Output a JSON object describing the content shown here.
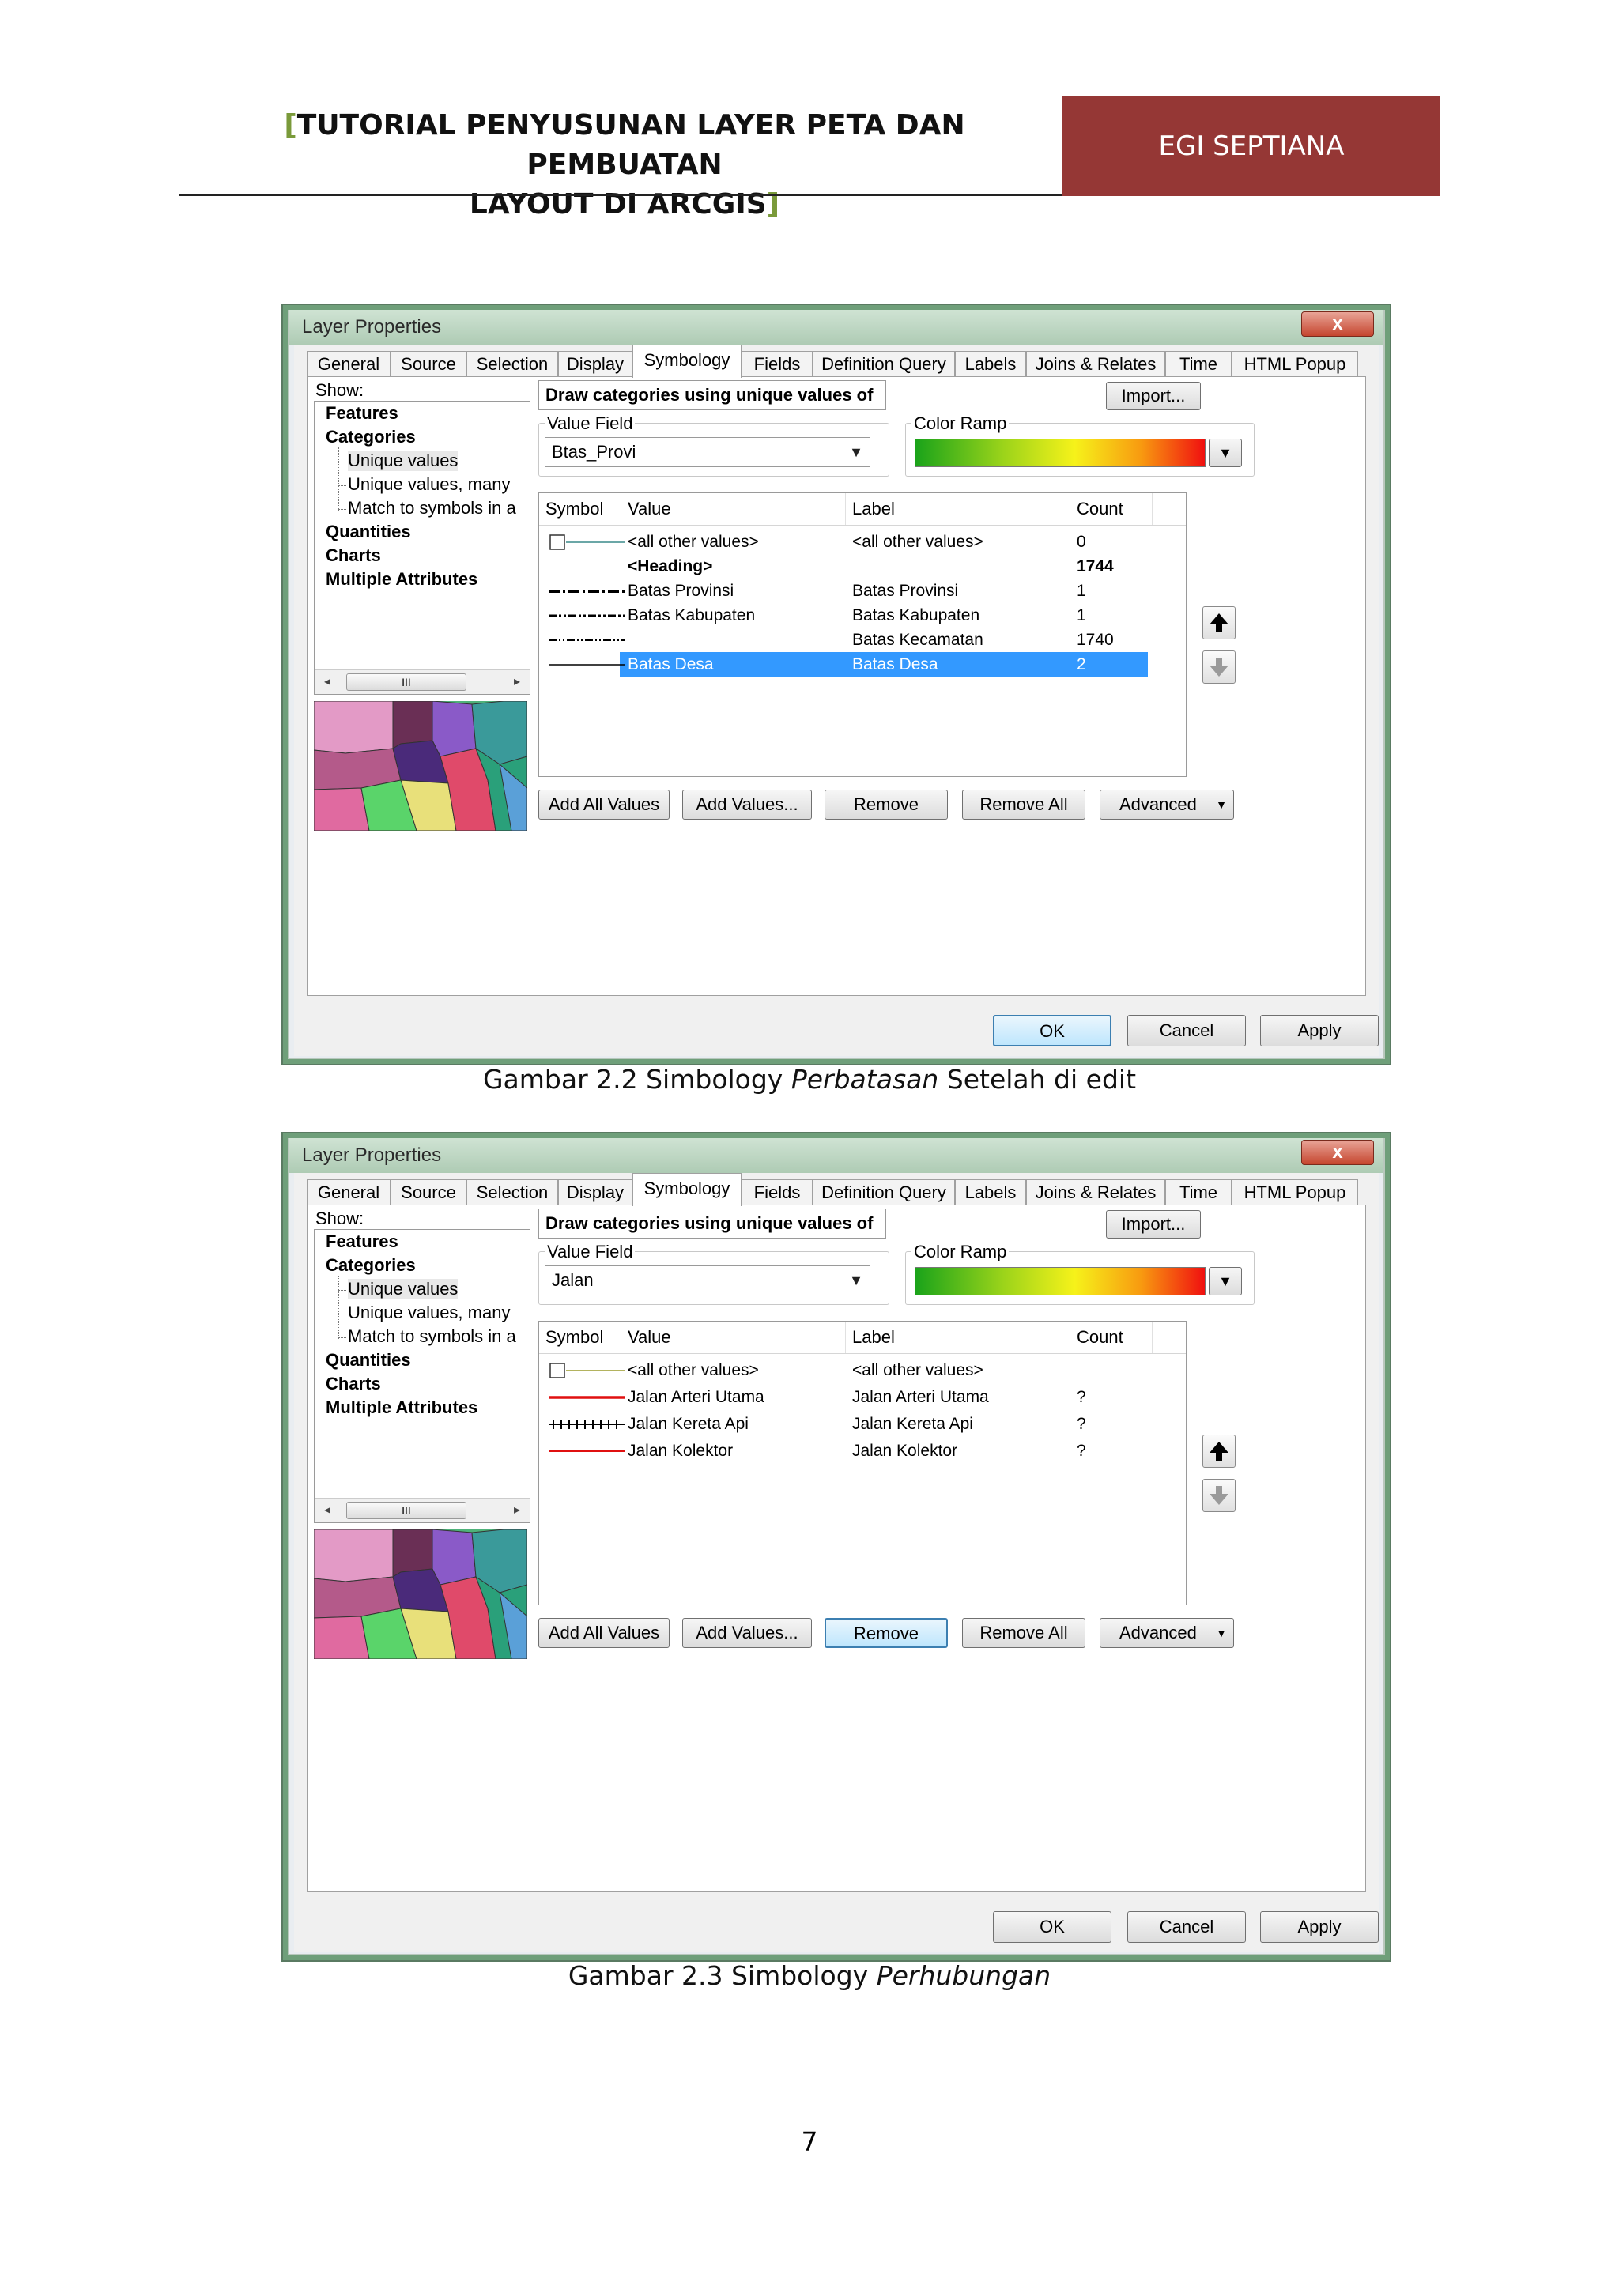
{
  "page": {
    "header_title_line1": "TUTORIAL PENYUSUNAN LAYER PETA DAN PEMBUATAN",
    "header_title_line2": "LAYOUT DI ARCGIS",
    "header_bracket_open": "[",
    "header_bracket_close": "]",
    "author": "EGI SEPTIANA",
    "page_number": "7",
    "colors": {
      "author_box": "#953735",
      "bracket": "#7a9a3a"
    }
  },
  "dialogs": [
    {
      "title": "Layer Properties",
      "close_label": "x",
      "tabs": [
        "General",
        "Source",
        "Selection",
        "Display",
        "Symbology",
        "Fields",
        "Definition Query",
        "Labels",
        "Joins & Relates",
        "Time",
        "HTML Popup"
      ],
      "active_tab": "Symbology",
      "show_label": "Show:",
      "tree": {
        "features": "Features",
        "categories": "Categories",
        "unique_values": "Unique values",
        "unique_values_many": "Unique values, many",
        "match_symbols": "Match to symbols in a",
        "quantities": "Quantities",
        "charts": "Charts",
        "multiple_attributes": "Multiple Attributes"
      },
      "scroll_thumb": "III",
      "draw_categories": "Draw categories using unique values of one field.",
      "import_label": "Import...",
      "value_field_label": "Value Field",
      "value_field": "Btas_Provi",
      "color_ramp_label": "Color Ramp",
      "columns": {
        "symbol": "Symbol",
        "value": "Value",
        "label": "Label",
        "count": "Count"
      },
      "rows": [
        {
          "symbol": "other",
          "value": "<all other values>",
          "label": "<all other values>",
          "count": "0"
        },
        {
          "symbol": "none",
          "value": "<Heading>",
          "label": "",
          "count": "1744",
          "bold": true
        },
        {
          "symbol": "dashdot-thick",
          "value": "Batas Provinsi",
          "label": "Batas Provinsi",
          "count": "1"
        },
        {
          "symbol": "dashdotdot",
          "value": "Batas Kabupaten",
          "label": "Batas Kabupaten",
          "count": "1"
        },
        {
          "symbol": "dashdot-thin",
          "value": "",
          "label": "Batas Kecamatan",
          "count": "1740"
        },
        {
          "symbol": "solid-thin",
          "value": "Batas Desa",
          "label": "Batas Desa",
          "count": "2",
          "selected": true
        }
      ],
      "buttons": {
        "add_all": "Add All Values",
        "add": "Add Values...",
        "remove": "Remove",
        "remove_all": "Remove All",
        "advanced": "Advanced"
      },
      "footer": {
        "ok": "OK",
        "cancel": "Cancel",
        "apply": "Apply"
      }
    },
    {
      "title": "Layer Properties",
      "close_label": "x",
      "tabs": [
        "General",
        "Source",
        "Selection",
        "Display",
        "Symbology",
        "Fields",
        "Definition Query",
        "Labels",
        "Joins & Relates",
        "Time",
        "HTML Popup"
      ],
      "active_tab": "Symbology",
      "show_label": "Show:",
      "tree": {
        "features": "Features",
        "categories": "Categories",
        "unique_values": "Unique values",
        "unique_values_many": "Unique values, many",
        "match_symbols": "Match to symbols in a",
        "quantities": "Quantities",
        "charts": "Charts",
        "multiple_attributes": "Multiple Attributes"
      },
      "scroll_thumb": "III",
      "draw_categories": "Draw categories using unique values of one field.",
      "import_label": "Import...",
      "value_field_label": "Value Field",
      "value_field": "Jalan",
      "color_ramp_label": "Color Ramp",
      "columns": {
        "symbol": "Symbol",
        "value": "Value",
        "label": "Label",
        "count": "Count"
      },
      "rows": [
        {
          "symbol": "other-olive",
          "value": "<all other values>",
          "label": "<all other values>",
          "count": ""
        },
        {
          "symbol": "red-thick",
          "value": "Jalan Arteri Utama",
          "label": "Jalan Arteri Utama",
          "count": "?"
        },
        {
          "symbol": "rail",
          "value": "Jalan Kereta Api",
          "label": "Jalan Kereta Api",
          "count": "?"
        },
        {
          "symbol": "red-thin",
          "value": "Jalan Kolektor",
          "label": "Jalan Kolektor",
          "count": "?"
        }
      ],
      "buttons": {
        "add_all": "Add All Values",
        "add": "Add Values...",
        "remove": "Remove",
        "remove_all": "Remove All",
        "advanced": "Advanced"
      },
      "footer": {
        "ok": "OK",
        "cancel": "Cancel",
        "apply": "Apply"
      }
    }
  ],
  "captions": [
    {
      "prefix": "Gambar 2.2 Simbology ",
      "italic": "Perbatasan",
      "suffix": " Setelah di edit"
    },
    {
      "prefix": "Gambar 2.3 Simbology ",
      "italic": "Perhubungan",
      "suffix": ""
    }
  ]
}
